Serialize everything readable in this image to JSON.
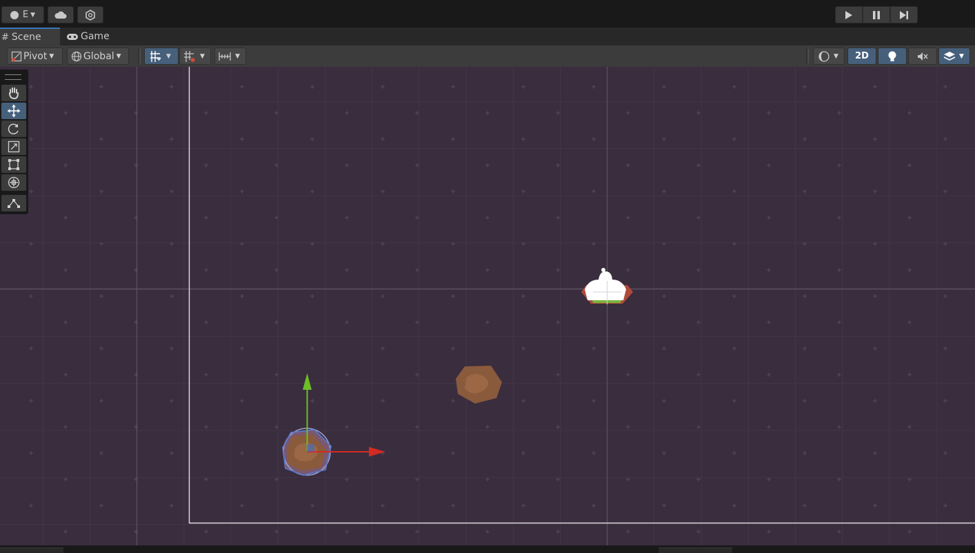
{
  "account": {
    "label": "E"
  },
  "tabs": [
    {
      "label": "Scene",
      "icon": "grid-icon",
      "active": true
    },
    {
      "label": "Game",
      "icon": "gamepad-icon",
      "active": false
    }
  ],
  "scene_toolbar": {
    "pivot_label": "Pivot",
    "global_label": "Global",
    "view_2d_label": "2D"
  },
  "tools": [
    "hand-tool",
    "move-tool",
    "rotate-tool",
    "scale-tool",
    "rect-tool",
    "transform-tool",
    "custom-tool"
  ],
  "selected_tool": "move-tool",
  "colors": {
    "scene_background": "#3a2d3e",
    "x_axis": "#d42a22",
    "y_axis": "#6cbf28",
    "selection_blue": "#46607c",
    "asteroid": "#8a5a3c"
  }
}
